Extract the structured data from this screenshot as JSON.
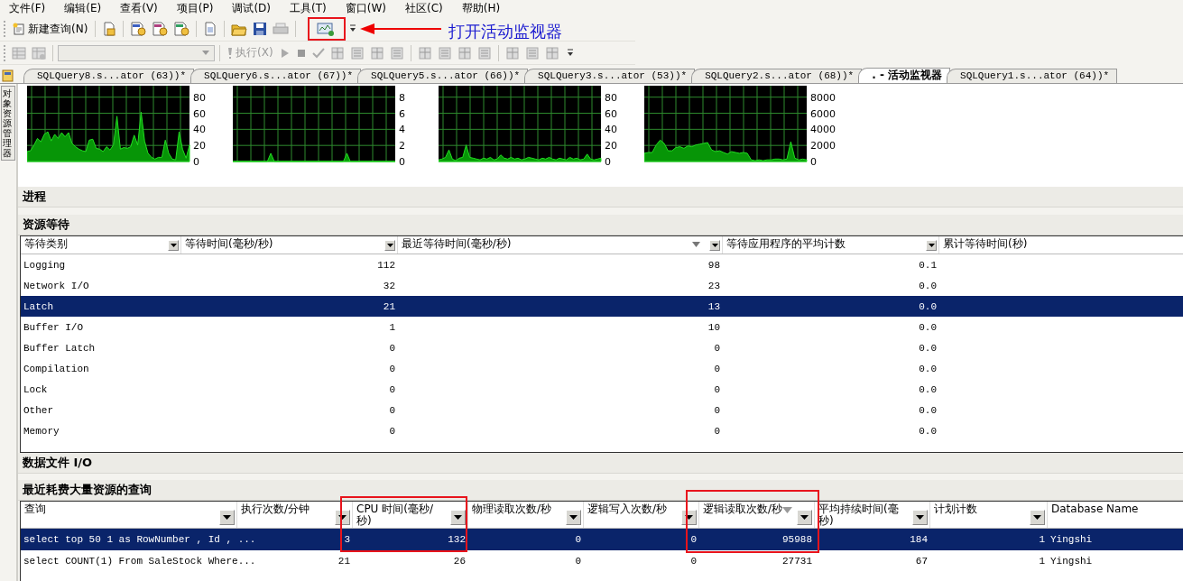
{
  "menu": [
    "文件(F)",
    "编辑(E)",
    "查看(V)",
    "项目(P)",
    "调试(D)",
    "工具(T)",
    "窗口(W)",
    "社区(C)",
    "帮助(H)"
  ],
  "toolbar": {
    "new_query": "新建查询(N)",
    "database_combo": {
      "disabled": true
    },
    "run": {
      "label": "执行(X)",
      "disabled": true
    }
  },
  "callout": {
    "text": "打开活动监视器"
  },
  "side_tab": "对象资源管理器",
  "tabs": [
    {
      "label": "SQLQuery8.s...ator (63))*",
      "selected": false
    },
    {
      "label": "SQLQuery6.s...ator (67))*",
      "selected": false
    },
    {
      "label": "SQLQuery5.s...ator (66))*",
      "selected": false
    },
    {
      "label": "SQLQuery3.s...ator (53))*",
      "selected": false
    },
    {
      "label": "SQLQuery2.s...ator (68))*",
      "selected": false
    },
    {
      "label": ". - 活动监视器",
      "selected": true
    },
    {
      "label": "SQLQuery1.s...ator (64))*",
      "selected": false
    }
  ],
  "charts": [
    {
      "chart_data": {
        "type": "area",
        "grid": true,
        "ylim": [
          0,
          92
        ],
        "yticks": [
          0,
          20,
          40,
          60,
          80
        ],
        "values": [
          12,
          13,
          20,
          28,
          24,
          33,
          36,
          25,
          33,
          28,
          35,
          30,
          35,
          22,
          18,
          15,
          13,
          12,
          26,
          27,
          16,
          15,
          12,
          18,
          14,
          20,
          55,
          15,
          17,
          16,
          18,
          32,
          20,
          60,
          25,
          10,
          5,
          3,
          5,
          5,
          26,
          10,
          3,
          2,
          36,
          15,
          4,
          20
        ]
      }
    },
    {
      "chart_data": {
        "type": "area",
        "grid": true,
        "ylim": [
          0,
          9.2
        ],
        "yticks": [
          0,
          2,
          4,
          6,
          8
        ],
        "values": [
          0,
          0,
          0,
          0,
          0,
          0,
          0,
          0,
          0,
          0,
          0,
          1,
          0,
          0,
          0,
          0,
          0,
          0,
          0,
          0,
          0,
          0,
          0,
          0,
          0,
          0,
          0,
          0,
          0,
          0,
          0,
          0,
          0,
          1,
          0,
          0,
          0,
          0,
          0,
          0,
          0,
          0,
          0,
          0,
          0,
          0,
          0,
          0
        ]
      }
    },
    {
      "chart_data": {
        "type": "area",
        "grid": true,
        "ylim": [
          0,
          92
        ],
        "yticks": [
          0,
          20,
          40,
          60,
          80
        ],
        "values": [
          2,
          3,
          5,
          14,
          3,
          1,
          4,
          5,
          20,
          5,
          4,
          3,
          2,
          4,
          3,
          5,
          2,
          3,
          8,
          4,
          3,
          5,
          3,
          4,
          2,
          3,
          5,
          4,
          3,
          2,
          4,
          3,
          5,
          3,
          2,
          4,
          3,
          2,
          5,
          3,
          4,
          2,
          3,
          9,
          3,
          2,
          3,
          4
        ]
      }
    },
    {
      "chart_data": {
        "type": "area",
        "grid": true,
        "ylim": [
          0,
          9200
        ],
        "yticks": [
          0,
          2000,
          4000,
          6000,
          8000
        ],
        "values": [
          1000,
          1100,
          1100,
          2000,
          2600,
          2200,
          1300,
          1300,
          1700,
          1800,
          1600,
          1900,
          1800,
          2000,
          2100,
          2200,
          2300,
          1400,
          1200,
          1300,
          1100,
          900,
          1200,
          1100,
          1000,
          1100,
          1000,
          200,
          100,
          200,
          100,
          200,
          200,
          300,
          300,
          200,
          300,
          2400,
          400,
          200,
          300,
          200
        ]
      }
    }
  ],
  "sections": {
    "processes": "进程",
    "resource_waits": {
      "title": "资源等待",
      "table": {
        "columns": [
          {
            "label": "等待类别",
            "sorted": false,
            "filter": true
          },
          {
            "label": "等待时间(毫秒/秒)",
            "sorted": false,
            "filter": true
          },
          {
            "label": "最近等待时间(毫秒/秒)",
            "sorted": true,
            "filter": true
          },
          {
            "label": "等待应用程序的平均计数",
            "sorted": false,
            "filter": true
          },
          {
            "label": "累计等待时间(秒)",
            "sorted": false,
            "filter": false
          }
        ],
        "rows": [
          {
            "cells": [
              "Logging",
              "112",
              "98",
              "0.1"
            ],
            "selected": false
          },
          {
            "cells": [
              "Network I/O",
              "32",
              "23",
              "0.0"
            ],
            "selected": false
          },
          {
            "cells": [
              "Latch",
              "21",
              "13",
              "0.0"
            ],
            "selected": true
          },
          {
            "cells": [
              "Buffer I/O",
              "1",
              "10",
              "0.0"
            ],
            "selected": false
          },
          {
            "cells": [
              "Buffer Latch",
              "0",
              "0",
              "0.0"
            ],
            "selected": false
          },
          {
            "cells": [
              "Compilation",
              "0",
              "0",
              "0.0"
            ],
            "selected": false
          },
          {
            "cells": [
              "Lock",
              "0",
              "0",
              "0.0"
            ],
            "selected": false
          },
          {
            "cells": [
              "Other",
              "0",
              "0",
              "0.0"
            ],
            "selected": false
          },
          {
            "cells": [
              "Memory",
              "0",
              "0",
              "0.0"
            ],
            "selected": false
          }
        ]
      }
    },
    "data_file_io": "数据文件 I/O",
    "expensive_queries": {
      "title": "最近耗费大量资源的查询",
      "table": {
        "columns": [
          {
            "label": "查询",
            "sorted": false,
            "filter": true
          },
          {
            "label": "执行次数/分钟",
            "sorted": false,
            "filter": true
          },
          {
            "label": "CPU 时间(毫秒/秒)",
            "sorted": false,
            "filter": true
          },
          {
            "label": "物理读取次数/秒",
            "sorted": false,
            "filter": true
          },
          {
            "label": "逻辑写入次数/秒",
            "sorted": false,
            "filter": true
          },
          {
            "label": "逻辑读取次数/秒",
            "sorted": true,
            "filter": true
          },
          {
            "label": "平均持续时间(毫秒)",
            "sorted": false,
            "filter": true
          },
          {
            "label": "计划计数",
            "sorted": false,
            "filter": true
          },
          {
            "label": "Database Name",
            "sorted": false,
            "filter": false
          }
        ],
        "rows": [
          {
            "cells": [
              "select top 50 1 as RowNumber , Id , ...",
              "3",
              "132",
              "0",
              "0",
              "95988",
              "184",
              "1",
              "Yingshi"
            ],
            "selected": true
          },
          {
            "cells": [
              "select COUNT(1) From SaleStock Where...",
              "21",
              "26",
              "0",
              "0",
              "27731",
              "67",
              "1",
              "Yingshi"
            ],
            "selected": false
          }
        ]
      }
    }
  }
}
